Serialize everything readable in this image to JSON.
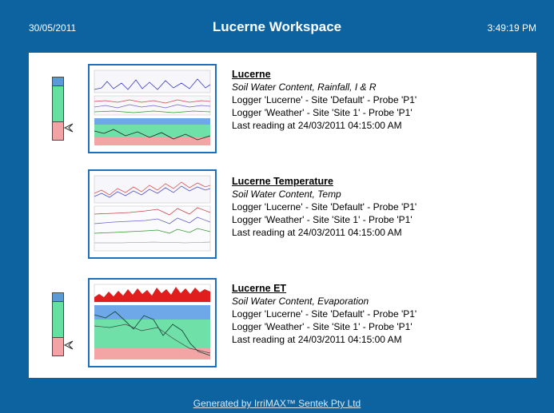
{
  "header": {
    "date": "30/05/2011",
    "title": "Lucerne Workspace",
    "time": "3:49:19 PM"
  },
  "items": [
    {
      "name": "Lucerne",
      "subtitle": "Soil Water Content, Rainfall, I & R",
      "lines": [
        "Logger 'Lucerne' - Site 'Default' - Probe 'P1'",
        "Logger 'Weather' - Site 'Site 1' - Probe 'P1'",
        "Last reading at 24/03/2011 04:15:00 AM"
      ],
      "has_gauge": true
    },
    {
      "name": "Lucerne Temperature",
      "subtitle": "Soil Water Content, Temp",
      "lines": [
        "Logger 'Lucerne' - Site 'Default' - Probe 'P1'",
        "Logger 'Weather' - Site 'Site 1' - Probe 'P1'",
        "Last reading at 24/03/2011 04:15:00 AM"
      ],
      "has_gauge": false
    },
    {
      "name": "Lucerne ET",
      "subtitle": "Soil Water Content, Evaporation",
      "lines": [
        "Logger 'Lucerne' - Site 'Default' - Probe 'P1'",
        "Logger 'Weather' - Site 'Site 1' - Probe 'P1'",
        "Last reading at 24/03/2011 04:15:00 AM"
      ],
      "has_gauge": true
    }
  ],
  "footer": {
    "text": "Generated by IrriMAX™ Sentek Pty Ltd"
  },
  "colors": {
    "background": "#0d63a0",
    "thumb_border": "#1f6fbf",
    "gauge_blue": "#5b9bd5",
    "gauge_green": "#66e0a0",
    "gauge_pink": "#f2a3a3"
  }
}
